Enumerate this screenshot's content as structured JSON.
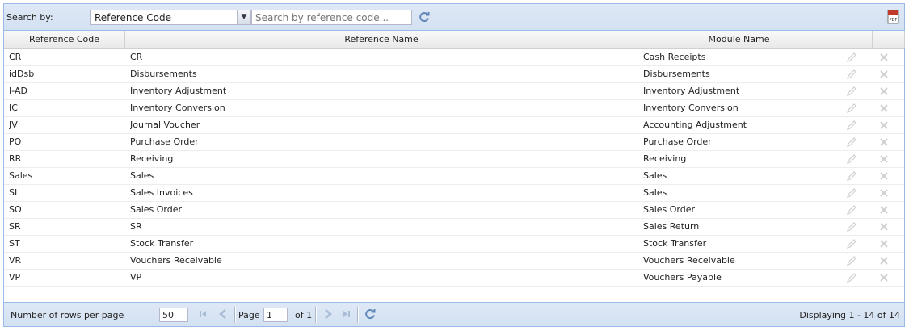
{
  "toolbar": {
    "search_by_label": "Search by:",
    "search_field": "Reference Code",
    "search_placeholder": "Search by reference code...",
    "refresh_icon": "refresh-icon",
    "pdf_icon": "pdf-export-icon"
  },
  "grid": {
    "columns": [
      "Reference Code",
      "Reference Name",
      "Module Name"
    ],
    "rows": [
      {
        "code": "CR",
        "name": "CR",
        "module": "Cash Receipts"
      },
      {
        "code": "idDsb",
        "name": "Disbursements",
        "module": "Disbursements"
      },
      {
        "code": "I-AD",
        "name": "Inventory Adjustment",
        "module": "Inventory Adjustment"
      },
      {
        "code": "IC",
        "name": "Inventory Conversion",
        "module": "Inventory Conversion"
      },
      {
        "code": "JV",
        "name": "Journal Voucher",
        "module": "Accounting Adjustment"
      },
      {
        "code": "PO",
        "name": "Purchase Order",
        "module": "Purchase Order"
      },
      {
        "code": "RR",
        "name": "Receiving",
        "module": "Receiving"
      },
      {
        "code": "Sales",
        "name": "Sales",
        "module": "Sales"
      },
      {
        "code": "SI",
        "name": "Sales Invoices",
        "module": "Sales"
      },
      {
        "code": "SO",
        "name": "Sales Order",
        "module": "Sales Order"
      },
      {
        "code": "SR",
        "name": "SR",
        "module": "Sales Return"
      },
      {
        "code": "ST",
        "name": "Stock Transfer",
        "module": "Stock Transfer"
      },
      {
        "code": "VR",
        "name": "Vouchers Receivable",
        "module": "Vouchers Receivable"
      },
      {
        "code": "VP",
        "name": "VP",
        "module": "Vouchers Payable"
      }
    ],
    "edit_icon": "pencil-icon",
    "delete_icon": "close-icon"
  },
  "footer": {
    "rows_per_page_label": "Number of rows per page",
    "rows_per_page_value": "50",
    "page_label": "Page",
    "page_value": "1",
    "of_label": "of 1",
    "display_text": "Displaying 1 - 14 of 14"
  },
  "colors": {
    "toolbar_bg": "#d3e1f1",
    "border": "#99bbe8",
    "icon_blue": "#5f86b8",
    "icon_disabled": "#c8c8c8"
  }
}
